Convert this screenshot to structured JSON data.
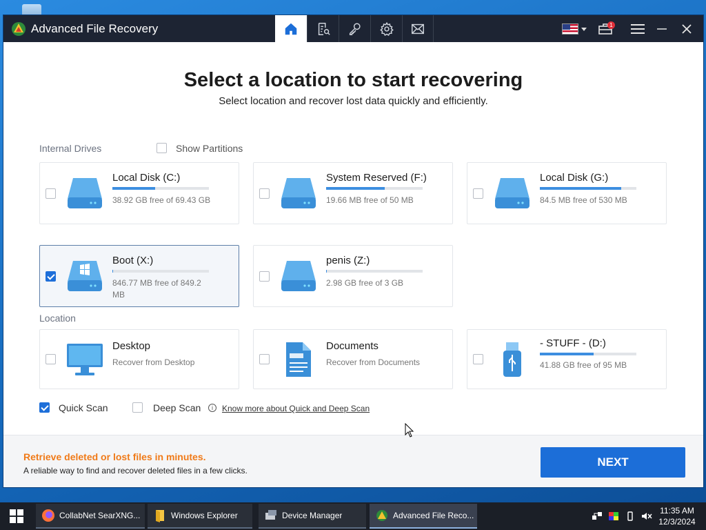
{
  "app": {
    "title": "Advanced File Recovery"
  },
  "header": {
    "title": "Select a location to start recovering",
    "subtitle": "Select location and recover lost data quickly and efficiently."
  },
  "internal_drives": {
    "label": "Internal Drives",
    "show_partitions_label": "Show Partitions",
    "items": [
      {
        "name": "Local Disk (C:)",
        "meta": "38.92 GB free of 69.43 GB",
        "used_fraction": 0.44,
        "checked": false
      },
      {
        "name": "System Reserved (F:)",
        "meta": "19.66 MB free of 50 MB",
        "used_fraction": 0.61,
        "checked": false
      },
      {
        "name": "Local Disk (G:)",
        "meta": "84.5 MB free of 530 MB",
        "used_fraction": 0.84,
        "checked": false
      },
      {
        "name": "Boot (X:)",
        "meta": "846.77 MB free of 849.2 MB",
        "used_fraction": 0.01,
        "checked": true
      },
      {
        "name": "penis (Z:)",
        "meta": "2.98 GB free of 3 GB",
        "used_fraction": 0.01,
        "checked": false
      }
    ]
  },
  "location": {
    "label": "Location",
    "items": [
      {
        "name": "Desktop",
        "meta": "Recover from Desktop"
      },
      {
        "name": "Documents",
        "meta": "Recover from Documents"
      },
      {
        "name": "- STUFF - (D:)",
        "meta": "41.88 GB free of 95 MB",
        "used_fraction": 0.56
      }
    ]
  },
  "scan": {
    "quick_label": "Quick Scan",
    "quick_checked": true,
    "deep_label": "Deep Scan",
    "deep_checked": false,
    "info_link": "Know more about Quick and Deep Scan"
  },
  "footer": {
    "title": "Retrieve deleted or lost files in minutes.",
    "subtitle": "A reliable way to find and recover deleted files in a few clicks.",
    "next_label": "NEXT"
  },
  "notification_count": "1",
  "taskbar": {
    "items": [
      {
        "label": "CollabNet SearXNG..."
      },
      {
        "label": "Windows Explorer"
      },
      {
        "label": "Device Manager"
      },
      {
        "label": "Advanced File Reco..."
      }
    ],
    "time": "11:35 AM",
    "date": "12/3/2024"
  },
  "colors": {
    "accent": "#1c6ed8",
    "titlebar": "#1d2433",
    "footer_highlight": "#f07a18"
  }
}
